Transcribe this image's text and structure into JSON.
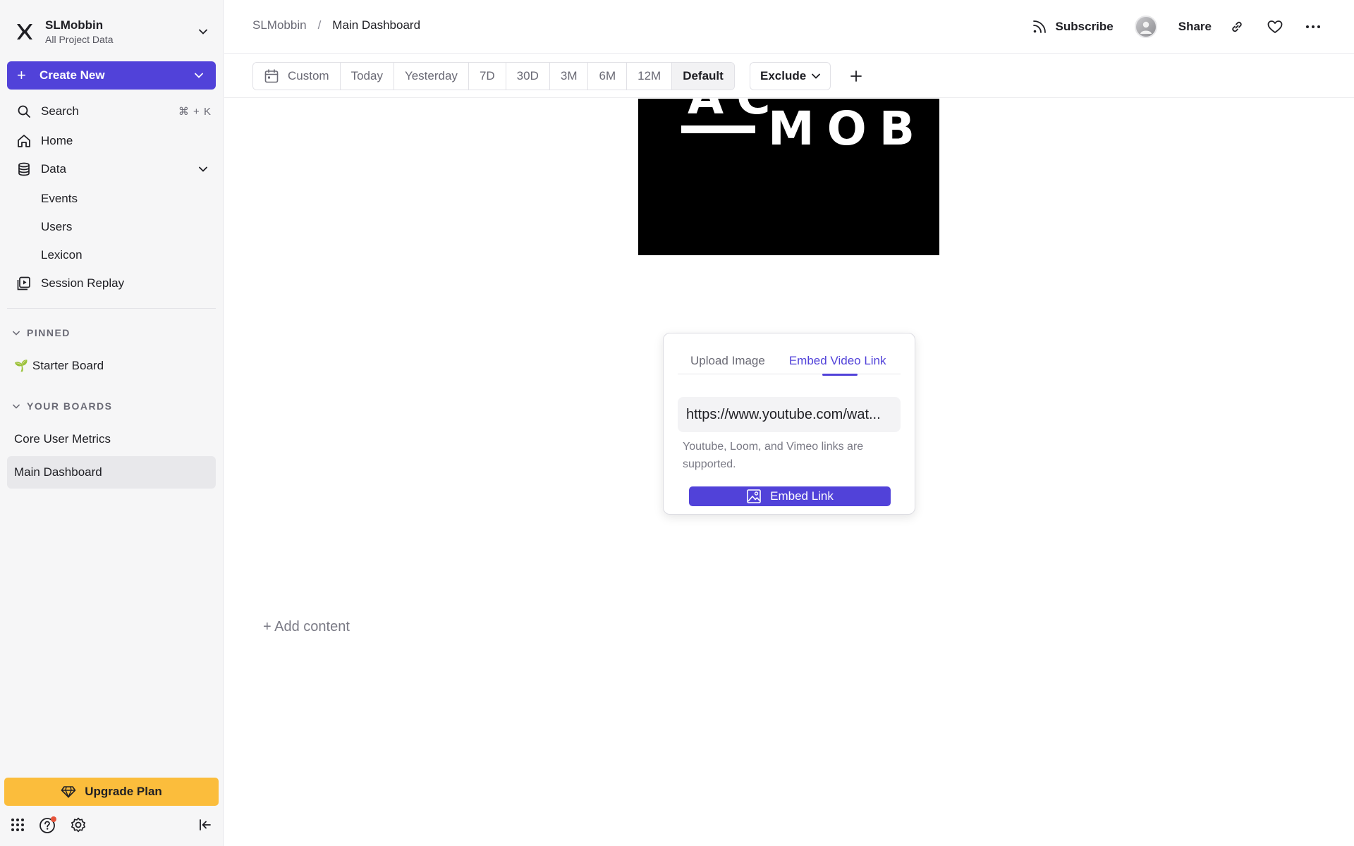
{
  "workspace": {
    "name": "SLMobbin",
    "subtitle": "All Project Data"
  },
  "sidebar": {
    "create_label": "Create New",
    "search": {
      "label": "Search",
      "shortcut": "⌘ + K"
    },
    "home_label": "Home",
    "data_label": "Data",
    "data_items": [
      "Events",
      "Users",
      "Lexicon"
    ],
    "session_replay_label": "Session Replay",
    "pinned_header": "PINNED",
    "pinned_items": [
      {
        "emoji": "🌱",
        "label": "Starter Board"
      }
    ],
    "boards_header": "YOUR BOARDS",
    "boards": [
      {
        "label": "Core User Metrics",
        "active": false
      },
      {
        "label": "Main Dashboard",
        "active": true
      }
    ],
    "upgrade_label": "Upgrade Plan"
  },
  "header": {
    "breadcrumb": {
      "parent": "SLMobbin",
      "separator": "/",
      "current": "Main Dashboard"
    },
    "subscribe_label": "Subscribe",
    "share_label": "Share"
  },
  "filters": {
    "ranges": [
      "Custom",
      "Today",
      "Yesterday",
      "7D",
      "30D",
      "3M",
      "6M",
      "12M",
      "Default"
    ],
    "active_range": "Default",
    "exclude_label": "Exclude"
  },
  "media": {
    "partial_text_top": "AC",
    "text": "MOB"
  },
  "embed_popover": {
    "tabs": [
      "Upload Image",
      "Embed Video Link"
    ],
    "active_tab": "Embed Video Link",
    "url_value": "https://www.youtube.com/wat...",
    "help_text": "Youtube, Loom, and Vimeo links are supported.",
    "button_label": "Embed Link"
  },
  "canvas": {
    "add_content_label": "+ Add content"
  },
  "colors": {
    "accent": "#5142d9",
    "upgrade": "#fbbd3c",
    "sidebar_bg": "#f6f6f7",
    "notification_dot": "#e5533a"
  }
}
